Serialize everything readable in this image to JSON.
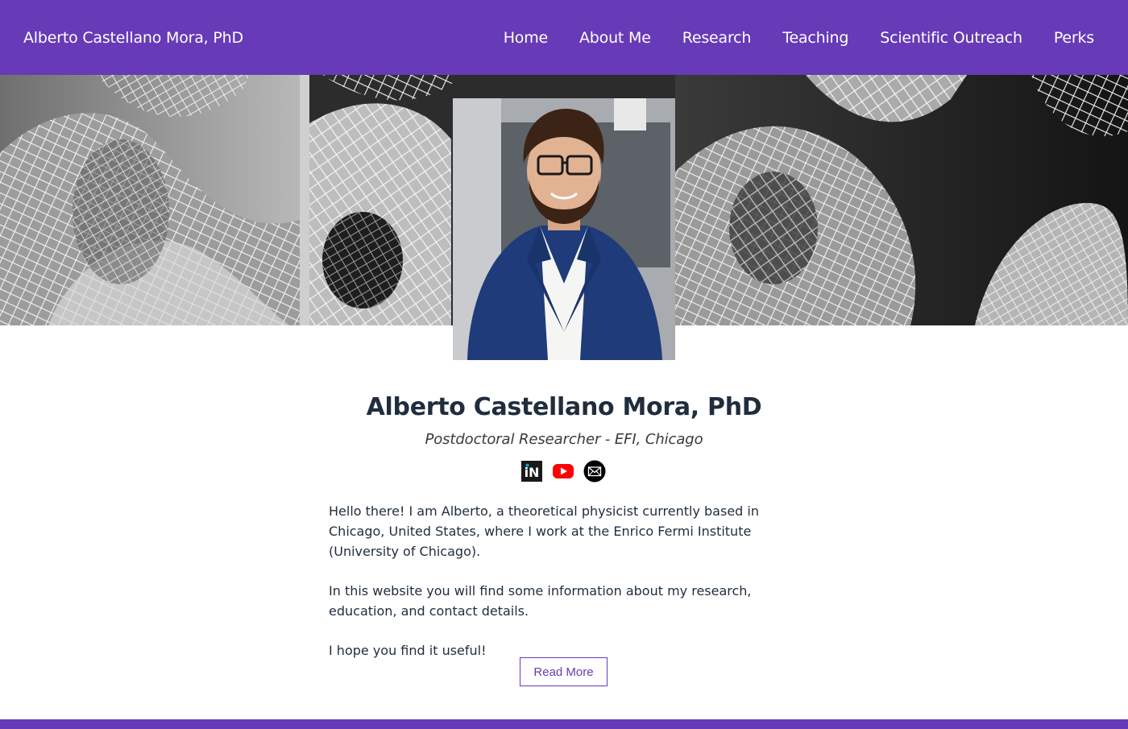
{
  "navbar": {
    "brand": "Alberto Castellano Mora, PhD",
    "links": [
      {
        "label": "Home"
      },
      {
        "label": "About Me"
      },
      {
        "label": "Research"
      },
      {
        "label": "Teaching"
      },
      {
        "label": "Scientific Outreach"
      },
      {
        "label": "Perks"
      }
    ]
  },
  "profile": {
    "name": "Alberto Castellano Mora, PhD",
    "subtitle": "Postdoctoral Researcher - EFI, Chicago",
    "social": [
      {
        "icon": "inspire-icon",
        "text": "iN"
      },
      {
        "icon": "youtube-icon"
      },
      {
        "icon": "email-icon"
      }
    ]
  },
  "bio": {
    "paragraphs": [
      "Hello there! I am Alberto, a theoretical physicist currently based in Chicago, United States, where I work at the Enrico Fermi Institute (University of Chicago).",
      "In this website you will find some information about my research, education, and contact details.",
      "I hope you find it useful!"
    ]
  },
  "read_more_label": "Read More",
  "colors": {
    "primary": "#673ab7",
    "text": "#1f2d3d",
    "youtube": "#ff0000"
  }
}
